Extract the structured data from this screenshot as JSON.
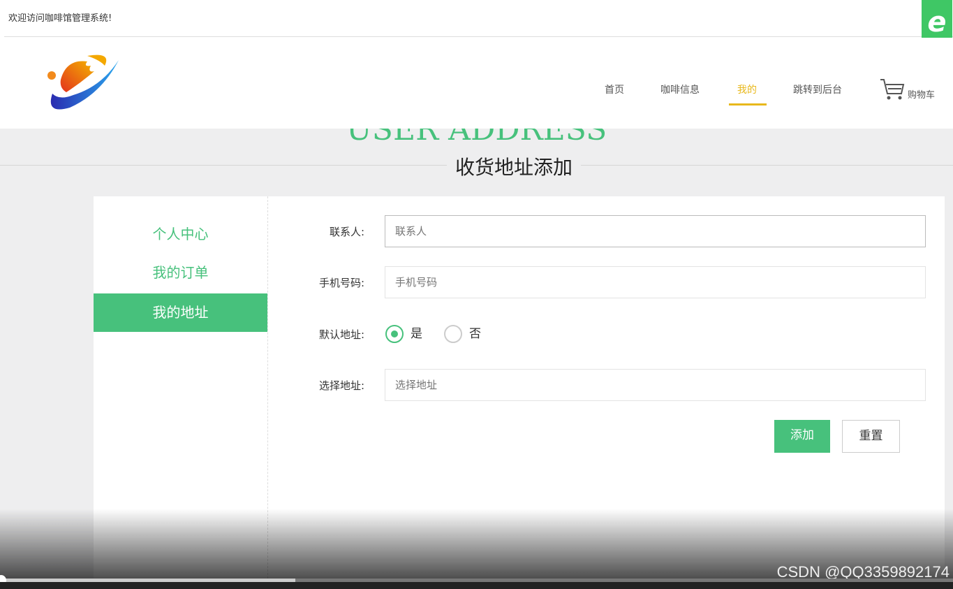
{
  "topbar": {
    "welcome": "欢迎访问咖啡馆管理系统!",
    "badge": "e"
  },
  "nav": {
    "items": [
      {
        "label": "首页"
      },
      {
        "label": "咖啡信息"
      },
      {
        "label": "我的",
        "active": true
      },
      {
        "label": "跳转到后台"
      }
    ],
    "cart": "购物车"
  },
  "page": {
    "title_en": "USER ADDRESS",
    "title": "收货地址添加"
  },
  "sidebar": {
    "items": [
      {
        "label": "个人中心"
      },
      {
        "label": "我的订单"
      },
      {
        "label": "我的地址",
        "active": true
      }
    ]
  },
  "form": {
    "contact": {
      "label": "联系人:",
      "placeholder": "联系人",
      "value": ""
    },
    "phone": {
      "label": "手机号码:",
      "placeholder": "手机号码",
      "value": ""
    },
    "default": {
      "label": "默认地址:",
      "options": [
        "是",
        "否"
      ],
      "selected": "是"
    },
    "address": {
      "label": "选择地址:",
      "placeholder": "选择地址",
      "value": ""
    },
    "add_button": "添加",
    "reset_button": "重置"
  },
  "video": {
    "watermark": "CSDN @QQ3359892174",
    "progress_percent": 31
  },
  "colors": {
    "accent": "#47c17c",
    "nav_active": "#e8b81c"
  }
}
